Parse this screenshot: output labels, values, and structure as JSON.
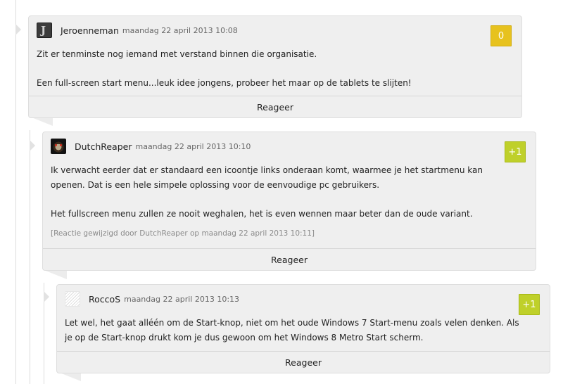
{
  "comments": [
    {
      "author": "Jeroenneman",
      "date": "maandag 22 april 2013 10:08",
      "score": "0",
      "paragraphs": [
        "Zit er tenminste nog iemand met verstand binnen die organisatie.",
        "Een full-screen start menu...leuk idee jongens, probeer het maar op de tablets te slijten!"
      ],
      "reply_label": "Reageer"
    },
    {
      "author": "DutchReaper",
      "date": "maandag 22 april 2013 10:10",
      "score": "+1",
      "paragraphs": [
        "Ik verwacht eerder dat er standaard een icoontje links onderaan komt, waarmee je het startmenu kan",
        "openen. Dat is een hele simpele oplossing voor de eenvoudige pc gebruikers.",
        "Het fullscreen menu zullen ze nooit weghalen, het is even wennen maar beter dan de oude variant."
      ],
      "edit_note": "[Reactie gewijzigd door DutchReaper op maandag 22 april 2013 10:11]",
      "reply_label": "Reageer"
    },
    {
      "author": "RoccoS",
      "date": "maandag 22 april 2013 10:13",
      "score": "+1",
      "paragraphs": [
        "Let wel, het gaat alléén om de Start-knop, niet om het oude Windows 7 Start-menu zoals velen denken. Als",
        "je op de Start-knop drukt kom je dus gewoon om het Windows 8 Metro Start scherm."
      ],
      "reply_label": "Reageer"
    }
  ],
  "colors": {
    "card_background": "#efefef",
    "score_neutral": "#e7c21e",
    "score_positive": "#bfd02a"
  }
}
